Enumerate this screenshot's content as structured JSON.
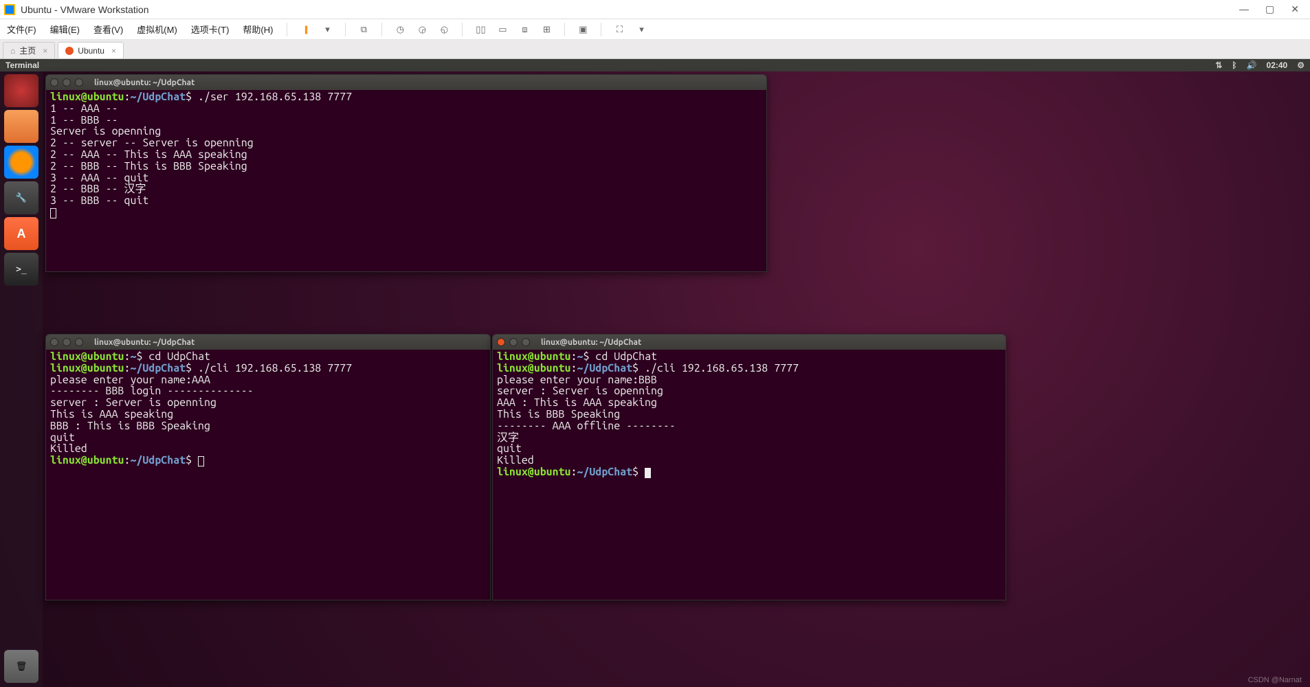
{
  "win": {
    "title": "Ubuntu - VMware Workstation",
    "min": "—",
    "max": "▢",
    "close": "✕"
  },
  "menu": {
    "file": "文件(F)",
    "edit": "编辑(E)",
    "view": "查看(V)",
    "vm": "虚拟机(M)",
    "tabs": "选项卡(T)",
    "help": "帮助(H)"
  },
  "tabs": {
    "home": "主页",
    "ubuntu": "Ubuntu"
  },
  "panel": {
    "app": "Terminal",
    "clock": "02:40"
  },
  "launcher": {
    "software_label": "A",
    "term_label": ">_"
  },
  "terminals": {
    "t1": {
      "title": "linux@ubuntu: ~/UdpChat",
      "lines": [
        {
          "prompt": "linux@ubuntu",
          "path": "~/UdpChat",
          "cmd": "./ser 192.168.65.138 7777"
        },
        {
          "text": "1 -- AAA --"
        },
        {
          "text": "1 -- BBB --"
        },
        {
          "text": "Server is openning"
        },
        {
          "text": "2 -- server -- Server is openning"
        },
        {
          "text": "2 -- AAA -- This is AAA speaking"
        },
        {
          "text": "2 -- BBB -- This is BBB Speaking"
        },
        {
          "text": "3 -- AAA -- quit"
        },
        {
          "text": "2 -- BBB -- 汉字"
        },
        {
          "text": "3 -- BBB -- quit"
        }
      ]
    },
    "t2": {
      "title": "linux@ubuntu: ~/UdpChat",
      "lines": [
        {
          "prompt": "linux@ubuntu",
          "path": "~",
          "cmd": "cd UdpChat"
        },
        {
          "prompt": "linux@ubuntu",
          "path": "~/UdpChat",
          "cmd": "./cli 192.168.65.138 7777"
        },
        {
          "text": "please enter your name:AAA"
        },
        {
          "text": "-------- BBB login --------------"
        },
        {
          "text": "server : Server is openning"
        },
        {
          "text": "This is AAA speaking"
        },
        {
          "text": "BBB : This is BBB Speaking"
        },
        {
          "text": "quit"
        },
        {
          "text": "Killed"
        },
        {
          "prompt": "linux@ubuntu",
          "path": "~/UdpChat",
          "cmd": "",
          "cursor": true
        }
      ]
    },
    "t3": {
      "title": "linux@ubuntu: ~/UdpChat",
      "lines": [
        {
          "prompt": "linux@ubuntu",
          "path": "~",
          "cmd": "cd UdpChat"
        },
        {
          "prompt": "linux@ubuntu",
          "path": "~/UdpChat",
          "cmd": "./cli 192.168.65.138 7777"
        },
        {
          "text": "please enter your name:BBB"
        },
        {
          "text": "server : Server is openning"
        },
        {
          "text": "AAA : This is AAA speaking"
        },
        {
          "text": "This is BBB Speaking"
        },
        {
          "text": "-------- AAA offline --------"
        },
        {
          "text": "汉字"
        },
        {
          "text": "quit"
        },
        {
          "text": "Killed"
        },
        {
          "prompt": "linux@ubuntu",
          "path": "~/UdpChat",
          "cmd": "",
          "cursor": true,
          "solid": true
        }
      ]
    }
  },
  "watermark": "CSDN @Narnat"
}
